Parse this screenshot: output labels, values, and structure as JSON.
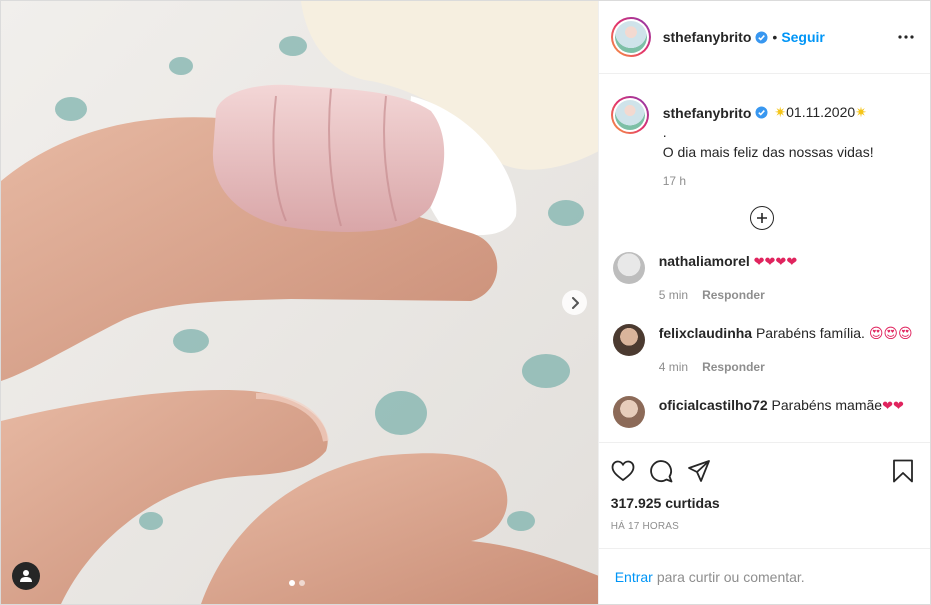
{
  "post": {
    "author": "sthefanybrito",
    "follow_label": "Seguir",
    "bullet": "•",
    "caption": {
      "date_text": "01.11.2020",
      "dot_line": ".",
      "text": "O dia mais feliz das nossas vidas!",
      "age": "17 h"
    },
    "comments": [
      {
        "user": "nathaliamorel",
        "text": "",
        "emojis": "❤❤❤❤",
        "age": "5 min",
        "reply_label": "Responder"
      },
      {
        "user": "felixclaudinha",
        "text": "Parabéns família.",
        "emojis": "😍😍😍",
        "age": "4 min",
        "reply_label": "Responder"
      },
      {
        "user": "oficialcastilho72",
        "text": "Parabéns mamãe",
        "emojis": "❤❤",
        "age": "",
        "reply_label": ""
      }
    ],
    "likes": "317.925 curtidas",
    "timestamp": "há 17 horas",
    "login": {
      "enter_label": "Entrar",
      "rest": "para curtir ou comentar."
    }
  },
  "carousel": {
    "slides": 2,
    "active": 0
  },
  "colors": {
    "accent": "#0095f6",
    "heart": "#e0245e"
  }
}
